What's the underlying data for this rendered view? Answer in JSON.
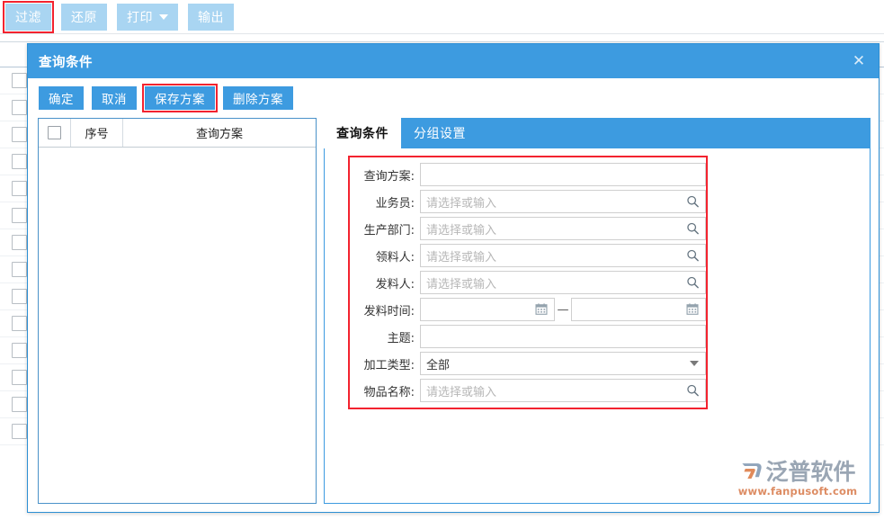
{
  "toolbar": {
    "buttons": [
      {
        "label": "过滤",
        "name": "filter-button",
        "highlighted": true,
        "dropdown": false
      },
      {
        "label": "还原",
        "name": "restore-button",
        "highlighted": false,
        "dropdown": false
      },
      {
        "label": "打印",
        "name": "print-button",
        "highlighted": false,
        "dropdown": true
      },
      {
        "label": "输出",
        "name": "export-button",
        "highlighted": false,
        "dropdown": false
      }
    ]
  },
  "dialog": {
    "title": "查询条件",
    "close_icon": "✕",
    "actions": [
      {
        "label": "确定",
        "name": "confirm-button",
        "highlighted": false
      },
      {
        "label": "取消",
        "name": "cancel-button",
        "highlighted": false
      },
      {
        "label": "保存方案",
        "name": "save-scheme-button",
        "highlighted": true
      },
      {
        "label": "删除方案",
        "name": "delete-scheme-button",
        "highlighted": false
      }
    ],
    "scheme_table": {
      "columns": [
        "",
        "序号",
        "查询方案"
      ],
      "rows": []
    },
    "tabs": [
      {
        "label": "查询条件",
        "active": true
      },
      {
        "label": "分组设置",
        "active": false
      }
    ],
    "form": {
      "fields": [
        {
          "label": "查询方案:",
          "type": "text",
          "value": "",
          "placeholder": "",
          "icon": "none"
        },
        {
          "label": "业务员:",
          "type": "lookup",
          "value": "",
          "placeholder": "请选择或输入",
          "icon": "search-icon"
        },
        {
          "label": "生产部门:",
          "type": "lookup",
          "value": "",
          "placeholder": "请选择或输入",
          "icon": "search-icon"
        },
        {
          "label": "领料人:",
          "type": "lookup",
          "value": "",
          "placeholder": "请选择或输入",
          "icon": "search-icon"
        },
        {
          "label": "发料人:",
          "type": "lookup",
          "value": "",
          "placeholder": "请选择或输入",
          "icon": "search-icon"
        },
        {
          "label": "发料时间:",
          "type": "daterange",
          "value": "",
          "value_end": "",
          "placeholder": "",
          "separator": "—",
          "icon": "calendar-icon"
        },
        {
          "label": "主题:",
          "type": "text",
          "value": "",
          "placeholder": "",
          "icon": "none"
        },
        {
          "label": "加工类型:",
          "type": "select",
          "value": "全部",
          "placeholder": "",
          "icon": "chevron-down-icon"
        },
        {
          "label": "物品名称:",
          "type": "lookup",
          "value": "",
          "placeholder": "请选择或输入",
          "icon": "search-icon"
        }
      ]
    }
  },
  "watermark": {
    "brand": "泛普软件",
    "url": "www.fanpusoft.com"
  },
  "colors": {
    "accent_blue": "#3d9be0",
    "toolbar_blue": "#a9d5f2",
    "highlight_red": "#f3232f",
    "watermark_gray": "#9aa6b4",
    "watermark_orange": "#dd8c63"
  }
}
